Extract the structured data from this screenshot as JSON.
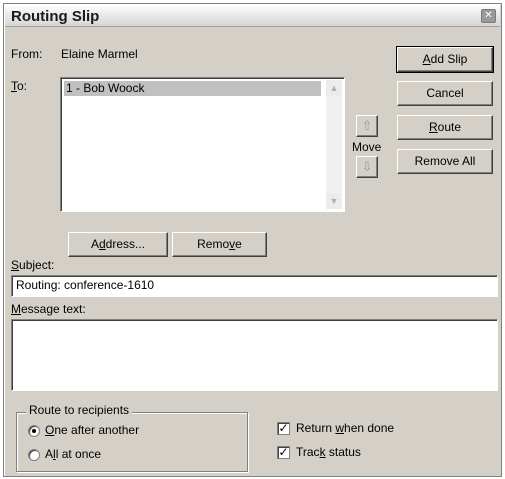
{
  "window": {
    "title": "Routing Slip",
    "close_glyph": "✕"
  },
  "from": {
    "label": "From:",
    "value": "Elaine Marmel"
  },
  "to": {
    "label": "To:",
    "recipients": [
      "1 - Bob Woock"
    ]
  },
  "move": {
    "label": "Move",
    "up_glyph": "⇧",
    "down_glyph": "⇩"
  },
  "buttons": {
    "add_slip": "Add Slip",
    "cancel": "Cancel",
    "route": "Route",
    "remove_all": "Remove All",
    "address": "Address...",
    "remove": "Remove"
  },
  "subject": {
    "label": "Subject:",
    "value": "Routing: conference-1610"
  },
  "message": {
    "label": "Message text:",
    "value": ""
  },
  "route_to_recipients": {
    "title": "Route to recipients",
    "options": [
      {
        "label": "One after another",
        "selected": true
      },
      {
        "label": "All at once",
        "selected": false
      }
    ]
  },
  "options": {
    "return_when_done": {
      "label": "Return when done",
      "checked": true
    },
    "track_status": {
      "label": "Track status",
      "checked": true
    }
  },
  "icons": {
    "close": "close-icon",
    "move_up": "arrow-up-icon",
    "move_down": "arrow-down-icon",
    "scroll_up": "scroll-up-arrow-icon",
    "scroll_down": "scroll-down-arrow-icon"
  }
}
